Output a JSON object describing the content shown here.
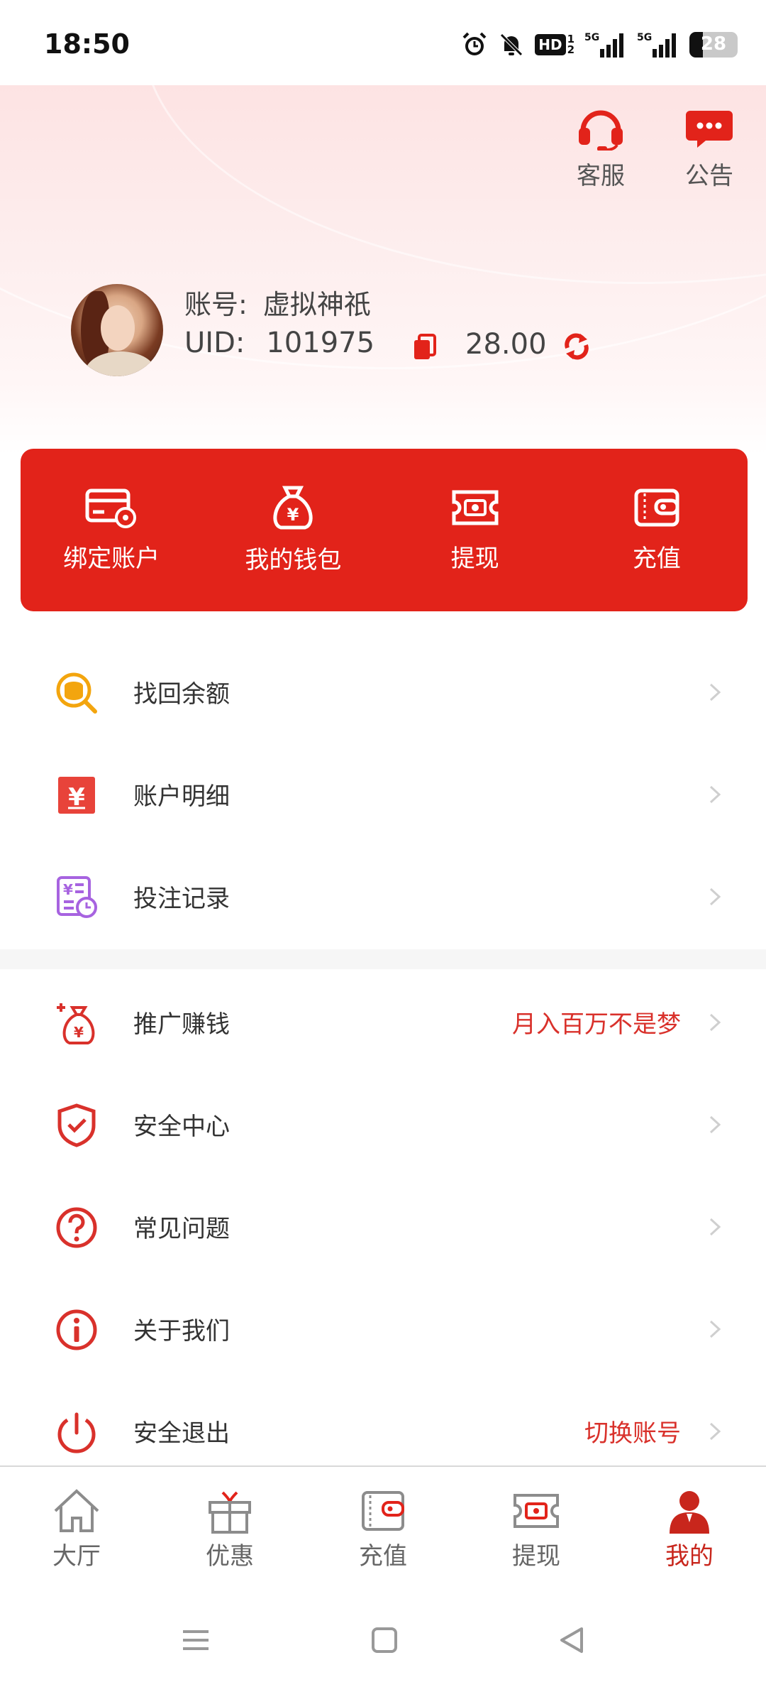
{
  "status_bar": {
    "time": "18:50",
    "hd_label": "HD",
    "hd_sub": "1\n2",
    "signal1_label": "5G",
    "signal2_label": "5G",
    "battery": "28"
  },
  "header": {
    "service_label": "客服",
    "notice_label": "公告",
    "account_key": "账号:",
    "account_value": "虚拟神祇",
    "uid_key": "UID:",
    "uid_value": "101975",
    "balance": "28.00"
  },
  "quick_actions": [
    {
      "label": "绑定账户",
      "icon": "card-settings-icon"
    },
    {
      "label": "我的钱包",
      "icon": "money-bag-icon"
    },
    {
      "label": "提现",
      "icon": "withdraw-ticket-icon"
    },
    {
      "label": "充值",
      "icon": "wallet-icon"
    }
  ],
  "menu_group1": [
    {
      "label": "找回余额",
      "icon": "coin-search-icon",
      "hint": ""
    },
    {
      "label": "账户明细",
      "icon": "yuan-document-icon",
      "hint": ""
    },
    {
      "label": "投注记录",
      "icon": "bet-record-icon",
      "hint": ""
    }
  ],
  "menu_group2": [
    {
      "label": "推广赚钱",
      "icon": "promotion-money-icon",
      "hint": "月入百万不是梦"
    },
    {
      "label": "安全中心",
      "icon": "shield-check-icon",
      "hint": ""
    },
    {
      "label": "常见问题",
      "icon": "question-icon",
      "hint": ""
    },
    {
      "label": "关于我们",
      "icon": "info-icon",
      "hint": ""
    },
    {
      "label": "安全退出",
      "icon": "power-icon",
      "hint": "切换账号"
    }
  ],
  "bottom_nav": [
    {
      "label": "大厅",
      "icon": "home-icon",
      "active": false
    },
    {
      "label": "优惠",
      "icon": "gift-icon",
      "active": false
    },
    {
      "label": "充值",
      "icon": "wallet-icon",
      "active": false
    },
    {
      "label": "提现",
      "icon": "withdraw-icon",
      "active": false
    },
    {
      "label": "我的",
      "icon": "user-icon",
      "active": true
    }
  ],
  "colors": {
    "brand_red": "#e2231a",
    "hint_red": "#d9312b",
    "active_tab": "#c8261c"
  }
}
